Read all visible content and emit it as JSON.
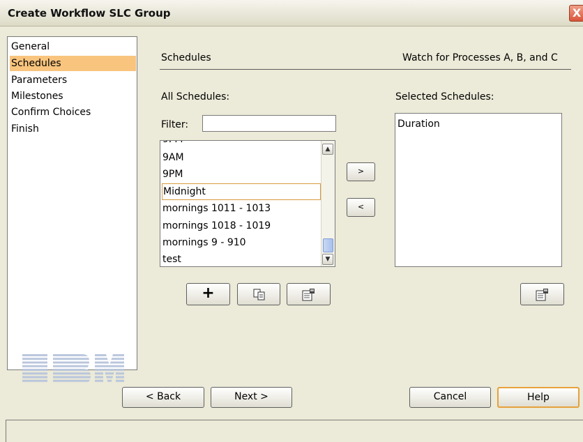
{
  "window": {
    "title": "Create Workflow SLC Group",
    "close_glyph": "X"
  },
  "nav": {
    "items": [
      {
        "label": "General"
      },
      {
        "label": "Schedules"
      },
      {
        "label": "Parameters"
      },
      {
        "label": "Milestones"
      },
      {
        "label": "Confirm Choices"
      },
      {
        "label": "Finish"
      }
    ],
    "selected": "Schedules",
    "logo": "IBM"
  },
  "panel": {
    "section_title": "Schedules",
    "group_name": "Watch for Processes A, B, and C"
  },
  "all_schedules": {
    "label": "All Schedules:",
    "filter_label": "Filter:",
    "filter_value": "",
    "items": [
      {
        "label": "9AM"
      },
      {
        "label": "9PM"
      },
      {
        "label": "Midnight"
      },
      {
        "label": "mornings 1011 - 1013"
      },
      {
        "label": "mornings 1018 - 1019"
      },
      {
        "label": "mornings 9 - 910"
      },
      {
        "label": "test"
      }
    ],
    "focused_item": "Midnight",
    "partial_top_item": "9PM"
  },
  "transfer": {
    "add_label": ">",
    "remove_label": "<"
  },
  "selected_schedules": {
    "label": "Selected Schedules:",
    "items": [
      {
        "label": "Duration"
      }
    ]
  },
  "buttons": {
    "new_label": "+",
    "back": "< Back",
    "next": "Next >",
    "cancel": "Cancel",
    "help": "Help"
  },
  "icons": {
    "new": "plus-icon",
    "copy": "copy-icon",
    "properties": "properties-icon"
  },
  "colors": {
    "background": "#ecead8",
    "selection": "#f8c47e",
    "focus_border": "#d79a3c",
    "default_button_border": "#e6a13c"
  }
}
